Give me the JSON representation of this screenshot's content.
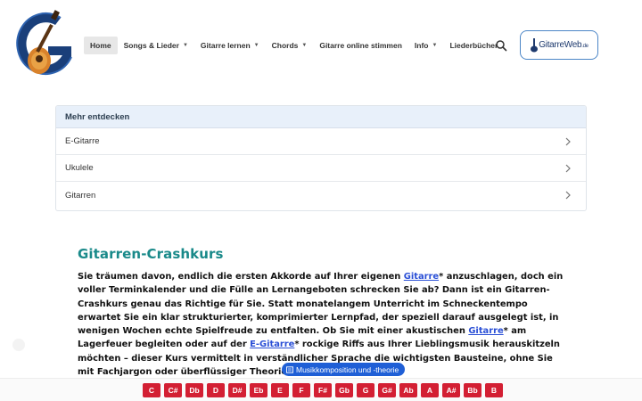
{
  "header": {
    "logo_icon": "guitar-g-logo-icon",
    "nav": [
      {
        "label": "Home",
        "active": true,
        "has_dropdown": false
      },
      {
        "label": "Songs & Lieder",
        "active": false,
        "has_dropdown": true
      },
      {
        "label": "Gitarre lernen",
        "active": false,
        "has_dropdown": true
      },
      {
        "label": "Chords",
        "active": false,
        "has_dropdown": true
      },
      {
        "label": "Gitarre online stimmen",
        "active": false,
        "has_dropdown": false
      },
      {
        "label": "Info",
        "active": false,
        "has_dropdown": true
      },
      {
        "label": "Liederbücher",
        "active": false,
        "has_dropdown": false
      }
    ],
    "search_icon": "search-icon",
    "brand": {
      "name": "GitarreWeb",
      "suffix": ".de"
    }
  },
  "discover": {
    "title": "Mehr entdecken",
    "items": [
      "E-Gitarre",
      "Ukulele",
      "Gitarren"
    ]
  },
  "article": {
    "title": "Gitarren-Crashkurs",
    "p1": "Sie träumen davon, endlich die ersten Akkorde auf Ihrer eigenen ",
    "link1": "Gitarre",
    "p2": "* anzuschlagen, doch ein voller Terminkalender und die Fülle an Lernangeboten schrecken Sie ab? Dann ist ein Gitarren-Crashkurs genau das Richtige für Sie. Statt monatelangem Unterricht im Schneckentempo erwartet Sie ein klar strukturierter, komprimierter Lernpfad, der speziell darauf ausgelegt ist, in wenigen Wochen echte Spielfreude zu entfalten. Ob Sie mit einer akustischen ",
    "link2": "Gitarre",
    "p3": "* am Lagerfeuer begleiten oder auf der ",
    "link3": "E-Gitarre",
    "p4": "* rockige Riffs aus Ihrer Lieblingsmusik herauskitzeln möchten – dieser Kurs vermittelt in verständlicher Sprache die wichtigsten Bausteine, ohne Sie mit Fachjargon oder überflüssiger Theorie zu überfordern."
  },
  "chip": {
    "icon": "book-icon",
    "label": "Musikkomposition und -theorie"
  },
  "notes": [
    "C",
    "C#",
    "Db",
    "D",
    "D#",
    "Eb",
    "E",
    "F",
    "F#",
    "Gb",
    "G",
    "G#",
    "Ab",
    "A",
    "A#",
    "Bb",
    "B"
  ],
  "colors": {
    "accent_teal": "#1a8a8a",
    "note_red": "#d31f33",
    "chip_blue": "#1f5fd6",
    "link_blue": "#2a4fd6"
  }
}
